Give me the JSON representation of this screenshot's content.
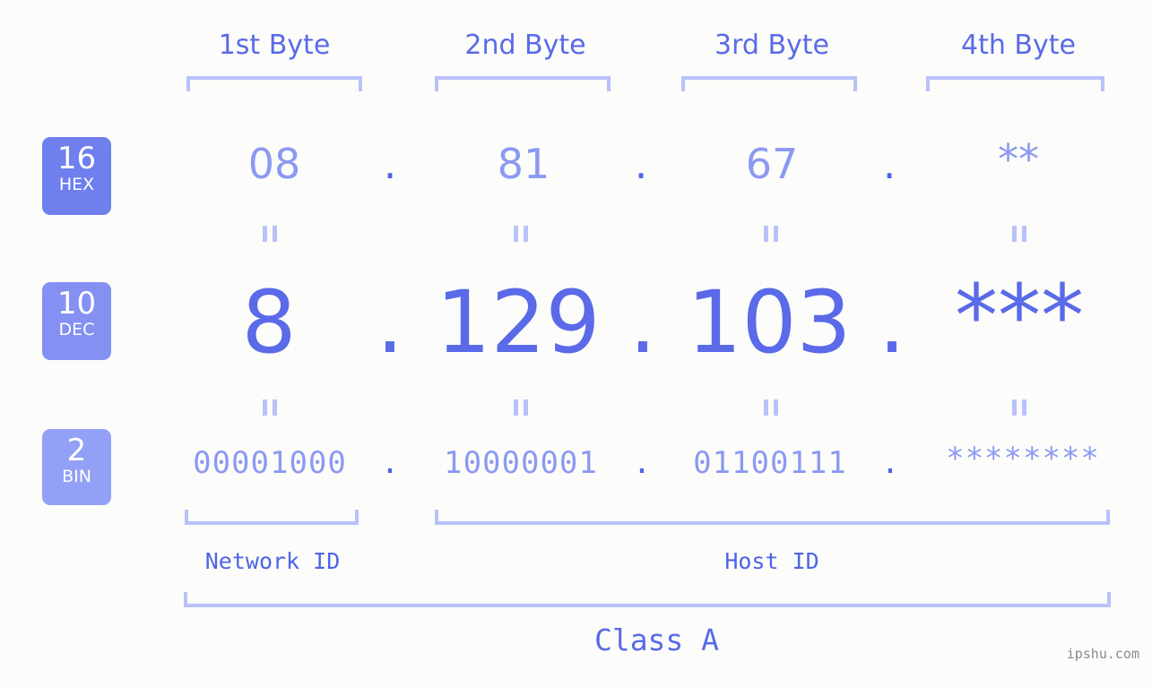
{
  "meta": {
    "watermark": "ipshu.com",
    "background_color": "#fcfdfa",
    "accent_color": "#5a6ae8",
    "light_accent_color": "#8c99f2",
    "bracket_color": "#b9c1fb"
  },
  "byte_headers": [
    {
      "label": "1st Byte"
    },
    {
      "label": "2nd Byte"
    },
    {
      "label": "3rd Byte"
    },
    {
      "label": "4th Byte"
    }
  ],
  "bases": [
    {
      "number": "16",
      "name": "HEX",
      "color": "#6f7fee"
    },
    {
      "number": "10",
      "name": "DEC",
      "color": "#8490f2"
    },
    {
      "number": "2",
      "name": "BIN",
      "color": "#92a1f5"
    }
  ],
  "rows": {
    "hex": {
      "base_number": "16",
      "base_name": "HEX",
      "values": [
        "08",
        "81",
        "67",
        "**"
      ],
      "separator": "."
    },
    "dec": {
      "base_number": "10",
      "base_name": "DEC",
      "values": [
        "8",
        "129",
        "103",
        "***"
      ],
      "separator": "."
    },
    "bin": {
      "base_number": "2",
      "base_name": "BIN",
      "values": [
        "00001000",
        "10000001",
        "01100111",
        "********"
      ],
      "separator": "."
    }
  },
  "equals_marks": {
    "glyph": "=",
    "count_per_row": 4
  },
  "id_spans": [
    {
      "label": "Network ID"
    },
    {
      "label": "Host ID"
    }
  ],
  "class": {
    "label": "Class A"
  }
}
